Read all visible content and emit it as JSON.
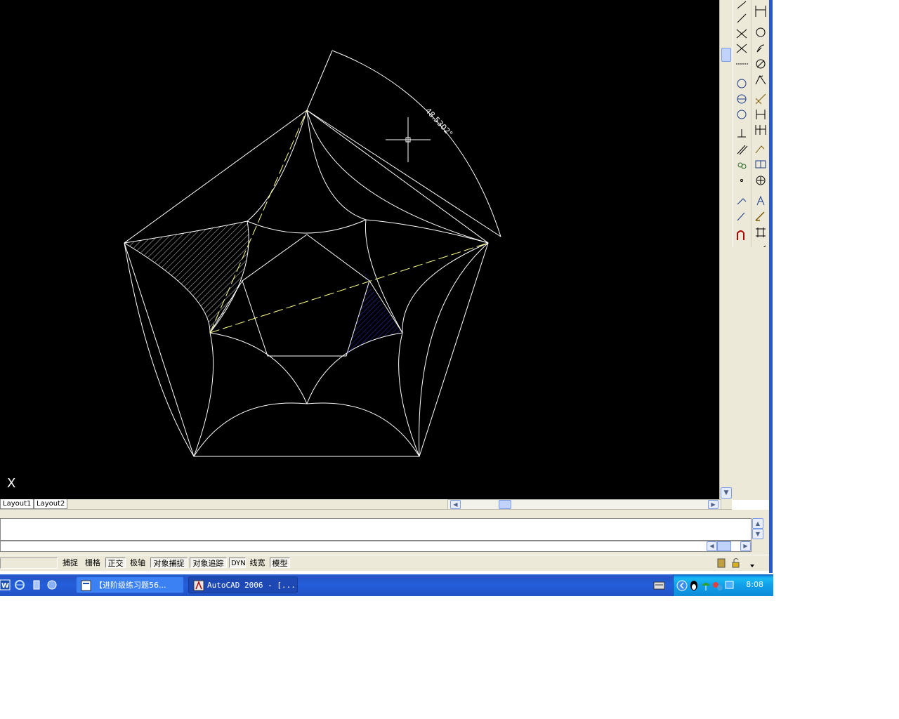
{
  "layout_tabs": [
    "Layout1",
    "Layout2"
  ],
  "drawing": {
    "dimension_text": "48.5302°",
    "ucs_label": "X"
  },
  "status_buttons": [
    {
      "label": "捕捉",
      "pressed": false
    },
    {
      "label": "栅格",
      "pressed": false
    },
    {
      "label": "正交",
      "pressed": true
    },
    {
      "label": "极轴",
      "pressed": false
    },
    {
      "label": "对象捕捉",
      "pressed": true
    },
    {
      "label": "对象追踪",
      "pressed": true
    },
    {
      "label": "DYN",
      "pressed": true
    },
    {
      "label": "线宽",
      "pressed": false
    },
    {
      "label": "模型",
      "pressed": true
    }
  ],
  "taskbar": {
    "tasks": [
      {
        "label": "【进阶级练习题56...",
        "active": false
      },
      {
        "label": "AutoCAD 2006 - [...",
        "active": true
      }
    ],
    "clock": "8:08"
  },
  "toolbars": {
    "draw_icons": [
      "line-icon",
      "ray-icon",
      "construction-line-icon",
      "multiline-icon",
      "polyline-icon",
      "polygon-icon",
      "rectangle-icon",
      "arc-icon",
      "circle-icon",
      "revision-cloud-icon",
      "spline-icon",
      "ellipse-icon",
      "ellipse-arc-icon",
      "insert-block-icon",
      "make-block-icon",
      "point-icon",
      "hatch-icon",
      "gradient-icon",
      "region-icon",
      "table-icon"
    ],
    "dimension_icons": [
      "linear-dim-icon",
      "aligned-dim-icon",
      "arc-length-icon",
      "ordinate-dim-icon",
      "radius-dim-icon",
      "jogged-dim-icon",
      "diameter-dim-icon",
      "angular-dim-icon",
      "quick-dim-icon",
      "baseline-dim-icon",
      "continue-dim-icon",
      "quick-leader-icon",
      "tolerance-icon",
      "center-mark-icon",
      "dim-edit-icon",
      "dim-text-edit-icon",
      "dim-update-icon",
      "dim-style-icon"
    ]
  },
  "colors": {
    "canvas_bg": "#000000",
    "geometry": "#ffffff",
    "centerline": "#ffff88",
    "hatch_white": "#ffffff",
    "hatch_blue": "#2a2ad0",
    "taskbar": "#245edb"
  }
}
